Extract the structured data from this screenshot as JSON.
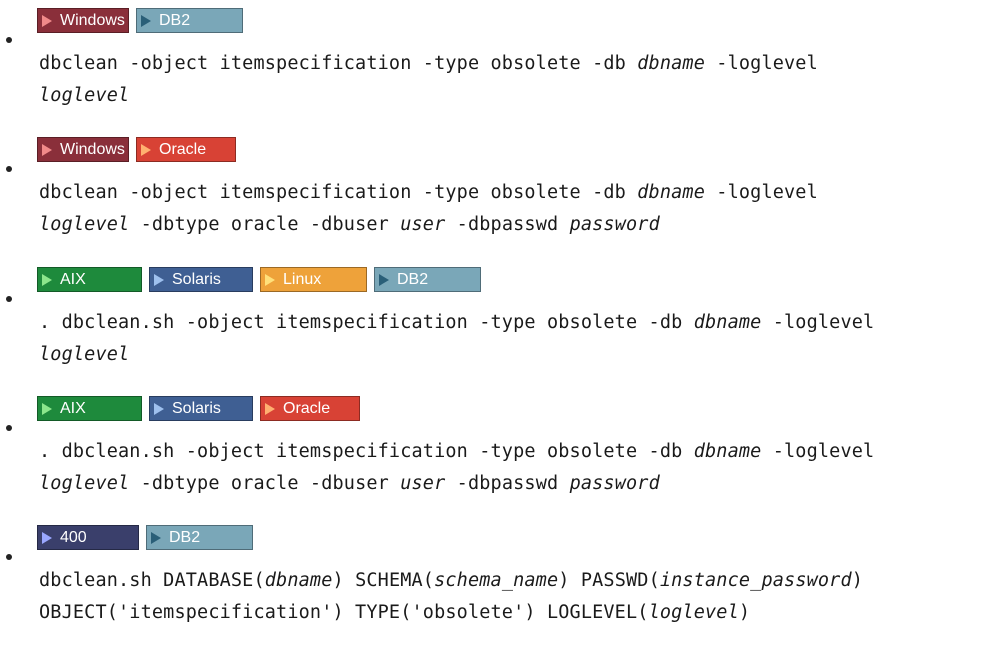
{
  "items": [
    {
      "tags": [
        {
          "label": "Windows",
          "bg": "#8a2f3a",
          "fg": "#ffffff",
          "tri": "#f08a8a",
          "w": 92
        },
        {
          "label": "DB2",
          "bg": "#7aa7b8",
          "fg": "#ffffff",
          "tri": "#2a5f78",
          "w": 107
        }
      ],
      "lines": [
        [
          [
            "t",
            "dbclean -object itemspecification -type obsolete -db "
          ],
          [
            "v",
            "dbname"
          ],
          [
            "t",
            " -loglevel"
          ]
        ],
        [
          [
            "v",
            "loglevel"
          ]
        ]
      ]
    },
    {
      "tags": [
        {
          "label": "Windows",
          "bg": "#8a2f3a",
          "fg": "#ffffff",
          "tri": "#f08a8a",
          "w": 92
        },
        {
          "label": "Oracle",
          "bg": "#d84235",
          "fg": "#ffffff",
          "tri": "#ffb070",
          "w": 100
        }
      ],
      "lines": [
        [
          [
            "t",
            "dbclean -object itemspecification -type obsolete -db "
          ],
          [
            "v",
            "dbname"
          ],
          [
            "t",
            " -loglevel"
          ]
        ],
        [
          [
            "v",
            "loglevel"
          ],
          [
            "t",
            " -dbtype oracle -dbuser "
          ],
          [
            "v",
            "user"
          ],
          [
            "t",
            " -dbpasswd "
          ],
          [
            "v",
            "password"
          ]
        ]
      ]
    },
    {
      "tags": [
        {
          "label": "AIX",
          "bg": "#1e8a3c",
          "fg": "#ffffff",
          "tri": "#8ce68c",
          "w": 105
        },
        {
          "label": "Solaris",
          "bg": "#3f5f93",
          "fg": "#ffffff",
          "tri": "#9ec0ee",
          "w": 104
        },
        {
          "label": "Linux",
          "bg": "#eea23a",
          "fg": "#ffffff",
          "tri": "#ffe07a",
          "w": 107
        },
        {
          "label": "DB2",
          "bg": "#7aa7b8",
          "fg": "#ffffff",
          "tri": "#2a5f78",
          "w": 107
        }
      ],
      "lines": [
        [
          [
            "t",
            ". dbclean.sh -object itemspecification -type obsolete -db "
          ],
          [
            "v",
            "dbname"
          ],
          [
            "t",
            " -loglevel"
          ]
        ],
        [
          [
            "v",
            "loglevel"
          ]
        ]
      ]
    },
    {
      "tags": [
        {
          "label": "AIX",
          "bg": "#1e8a3c",
          "fg": "#ffffff",
          "tri": "#8ce68c",
          "w": 105
        },
        {
          "label": "Solaris",
          "bg": "#3f5f93",
          "fg": "#ffffff",
          "tri": "#9ec0ee",
          "w": 104
        },
        {
          "label": "Oracle",
          "bg": "#d84235",
          "fg": "#ffffff",
          "tri": "#ffb070",
          "w": 100
        }
      ],
      "lines": [
        [
          [
            "t",
            ". dbclean.sh -object itemspecification -type obsolete -db "
          ],
          [
            "v",
            "dbname"
          ],
          [
            "t",
            " -loglevel"
          ]
        ],
        [
          [
            "v",
            "loglevel"
          ],
          [
            "t",
            " -dbtype oracle -dbuser "
          ],
          [
            "v",
            "user"
          ],
          [
            "t",
            " -dbpasswd "
          ],
          [
            "v",
            "password"
          ]
        ]
      ]
    },
    {
      "tags": [
        {
          "label": "400",
          "bg": "#3a3f6b",
          "fg": "#ffffff",
          "tri": "#9aa7ff",
          "w": 102
        },
        {
          "label": "DB2",
          "bg": "#7aa7b8",
          "fg": "#ffffff",
          "tri": "#2a5f78",
          "w": 107
        }
      ],
      "lines": [
        [
          [
            "t",
            "dbclean.sh DATABASE("
          ],
          [
            "v",
            "dbname"
          ],
          [
            "t",
            ") SCHEMA("
          ],
          [
            "v",
            "schema_name"
          ],
          [
            "t",
            ") PASSWD("
          ],
          [
            "v",
            "instance_password"
          ],
          [
            "t",
            ")"
          ]
        ],
        [
          [
            "t",
            "OBJECT('itemspecification') TYPE('obsolete') LOGLEVEL("
          ],
          [
            "v",
            "loglevel"
          ],
          [
            "t",
            ")"
          ]
        ]
      ]
    }
  ]
}
